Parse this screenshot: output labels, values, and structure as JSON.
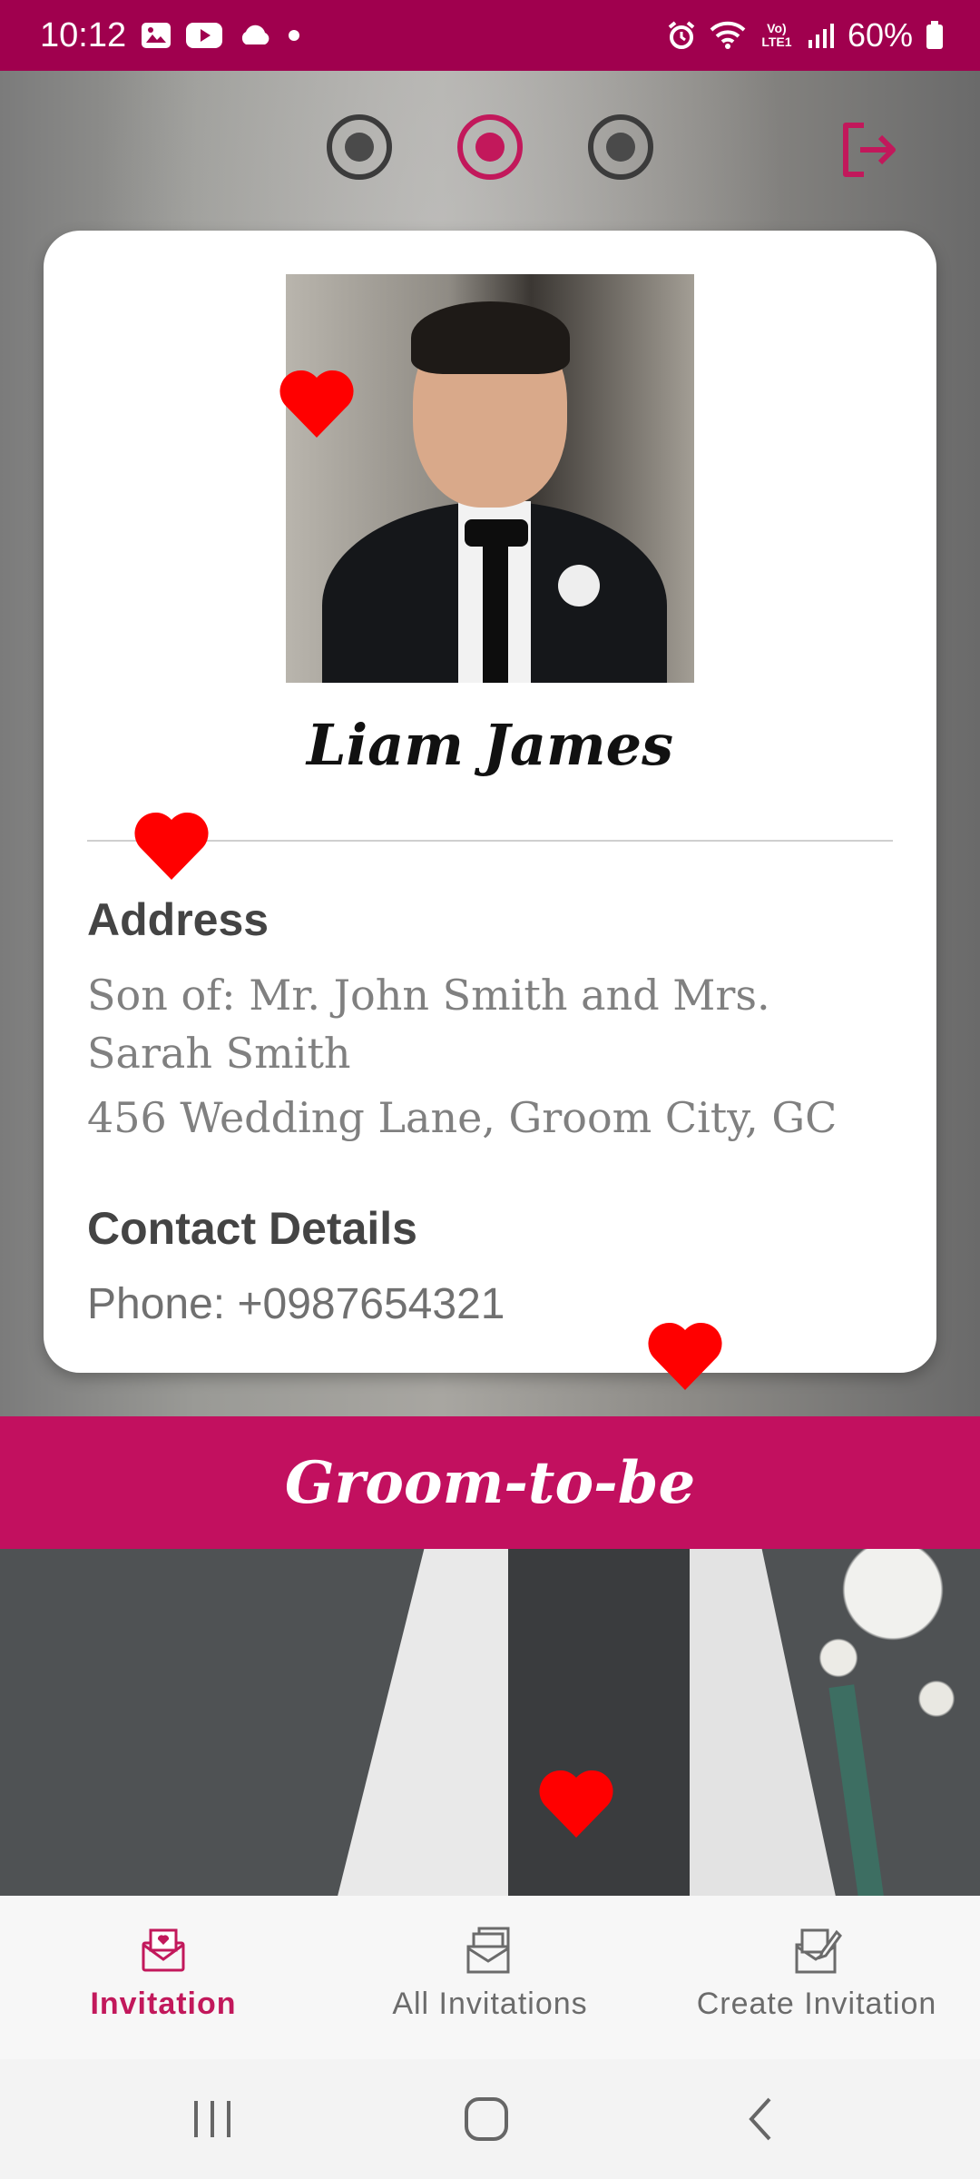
{
  "status_bar": {
    "time": "10:12",
    "battery": "60%",
    "icons_left": [
      "gallery-icon",
      "youtube-icon",
      "cloud-icon",
      "dot-icon"
    ],
    "icons_right": [
      "alarm-icon",
      "wifi-icon",
      "volte-icon",
      "signal-icon",
      "battery-icon"
    ],
    "volte_label": "Vo) LTE1"
  },
  "pager": {
    "count": 3,
    "active_index": 1
  },
  "card": {
    "name": "Liam James",
    "address_heading": "Address",
    "parents": "Son of: Mr. John Smith and Mrs. Sarah Smith",
    "address": "456 Wedding Lane, Groom City, GC",
    "contact_heading": "Contact Details",
    "phone": "Phone: +0987654321"
  },
  "banner": {
    "label": "Groom-to-be"
  },
  "bottom_nav": {
    "items": [
      {
        "label": "Invitation",
        "icon": "invitation-envelope-icon",
        "active": true
      },
      {
        "label": "All Invitations",
        "icon": "all-invitations-icon",
        "active": false
      },
      {
        "label": "Create Invitation",
        "icon": "create-invitation-icon",
        "active": false
      }
    ]
  },
  "colors": {
    "status_bar": "#a0004e",
    "accent": "#c2185b",
    "heart": "#ff0000",
    "card": "#ffffff"
  }
}
